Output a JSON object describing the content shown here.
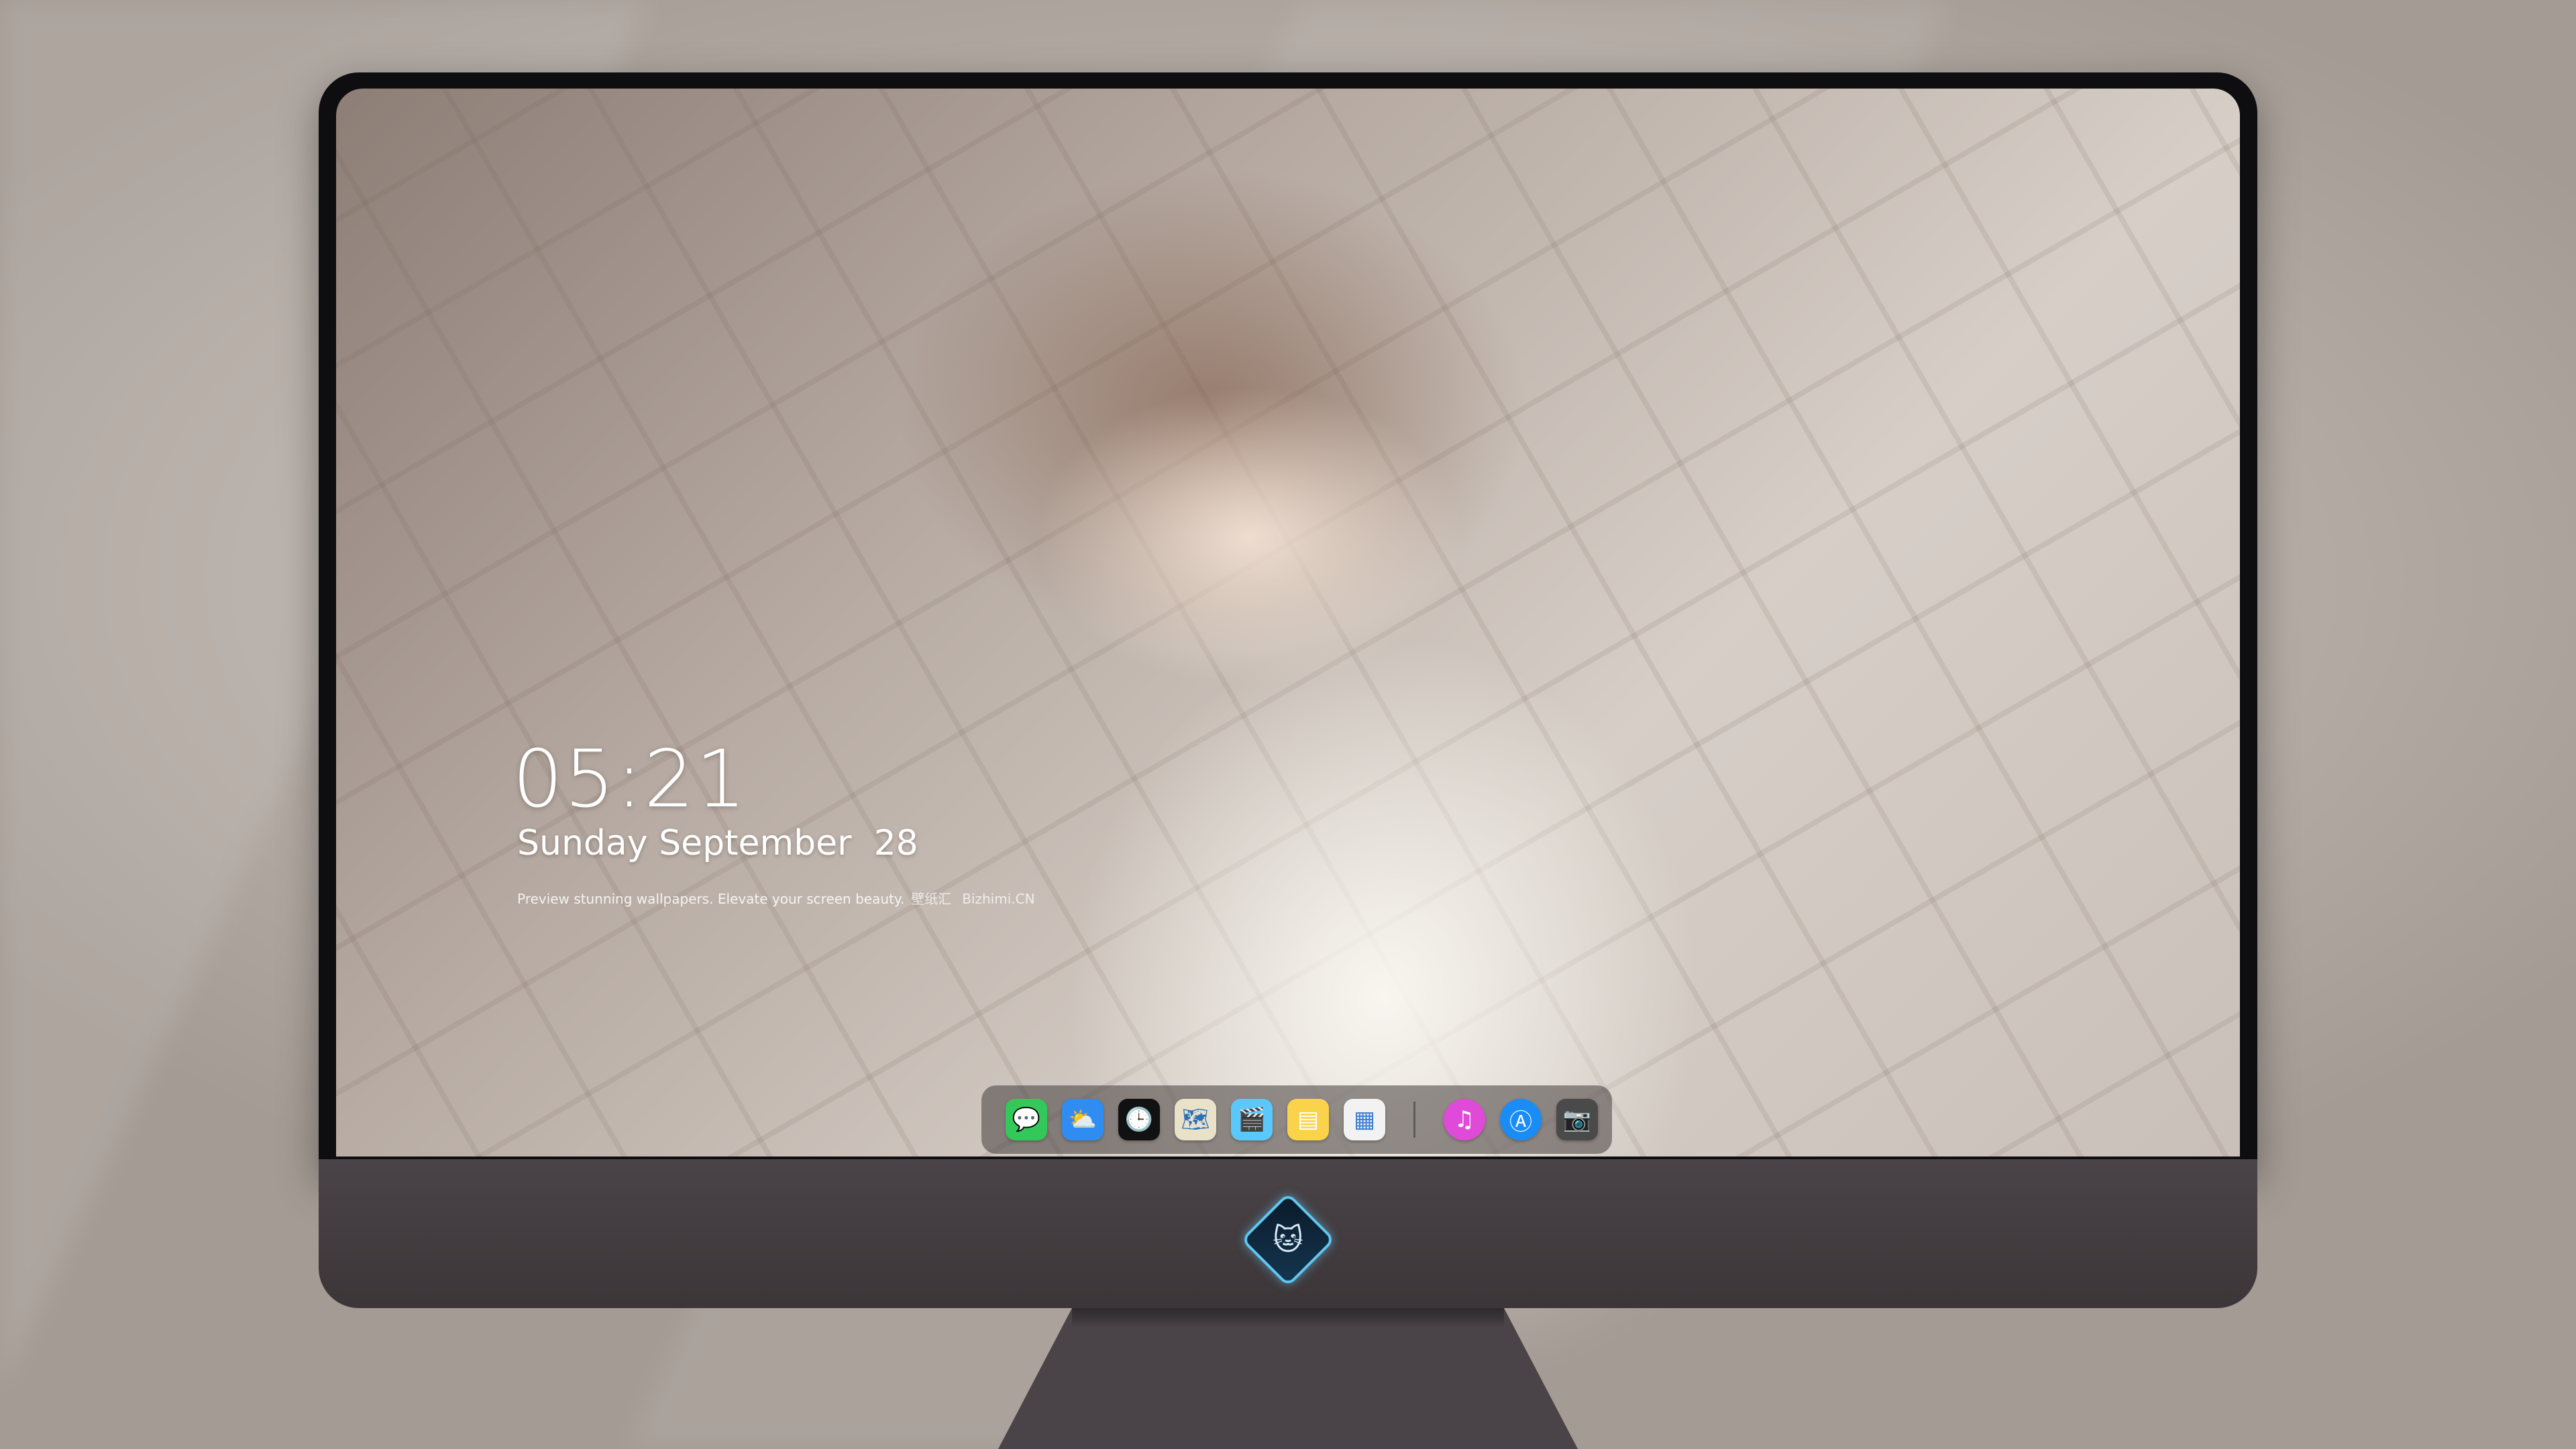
{
  "lockscreen": {
    "time": "05:21",
    "date": "Sunday September  28",
    "tagline": "Preview stunning wallpapers. Elevate your screen beauty.",
    "brand": "壁纸汇",
    "domain": "Bizhimi.CN"
  },
  "dock": {
    "apps": [
      {
        "name": "messages-icon",
        "glyph": "💬",
        "color": "#34c759"
      },
      {
        "name": "weather-icon",
        "glyph": "⛅",
        "color": "#2f8cf0"
      },
      {
        "name": "clock-icon",
        "glyph": "🕒",
        "color": "#111111"
      },
      {
        "name": "maps-icon",
        "glyph": "🗺",
        "color": "#e9e2c9"
      },
      {
        "name": "videos-icon",
        "glyph": "🎬",
        "color": "#5ac8fa"
      },
      {
        "name": "notes-icon",
        "glyph": "▤",
        "color": "#fbd34b"
      },
      {
        "name": "calendar-icon",
        "glyph": "▦",
        "color": "#f2f2f2"
      },
      {
        "name": "itunes-icon",
        "glyph": "♫",
        "color": "#e04ad8"
      },
      {
        "name": "app-store-icon",
        "glyph": "Ⓐ",
        "color": "#1a8cf5"
      },
      {
        "name": "camera-icon",
        "glyph": "📷",
        "color": "#4a4a4a"
      }
    ]
  },
  "monitor": {
    "logo": "🐱"
  }
}
